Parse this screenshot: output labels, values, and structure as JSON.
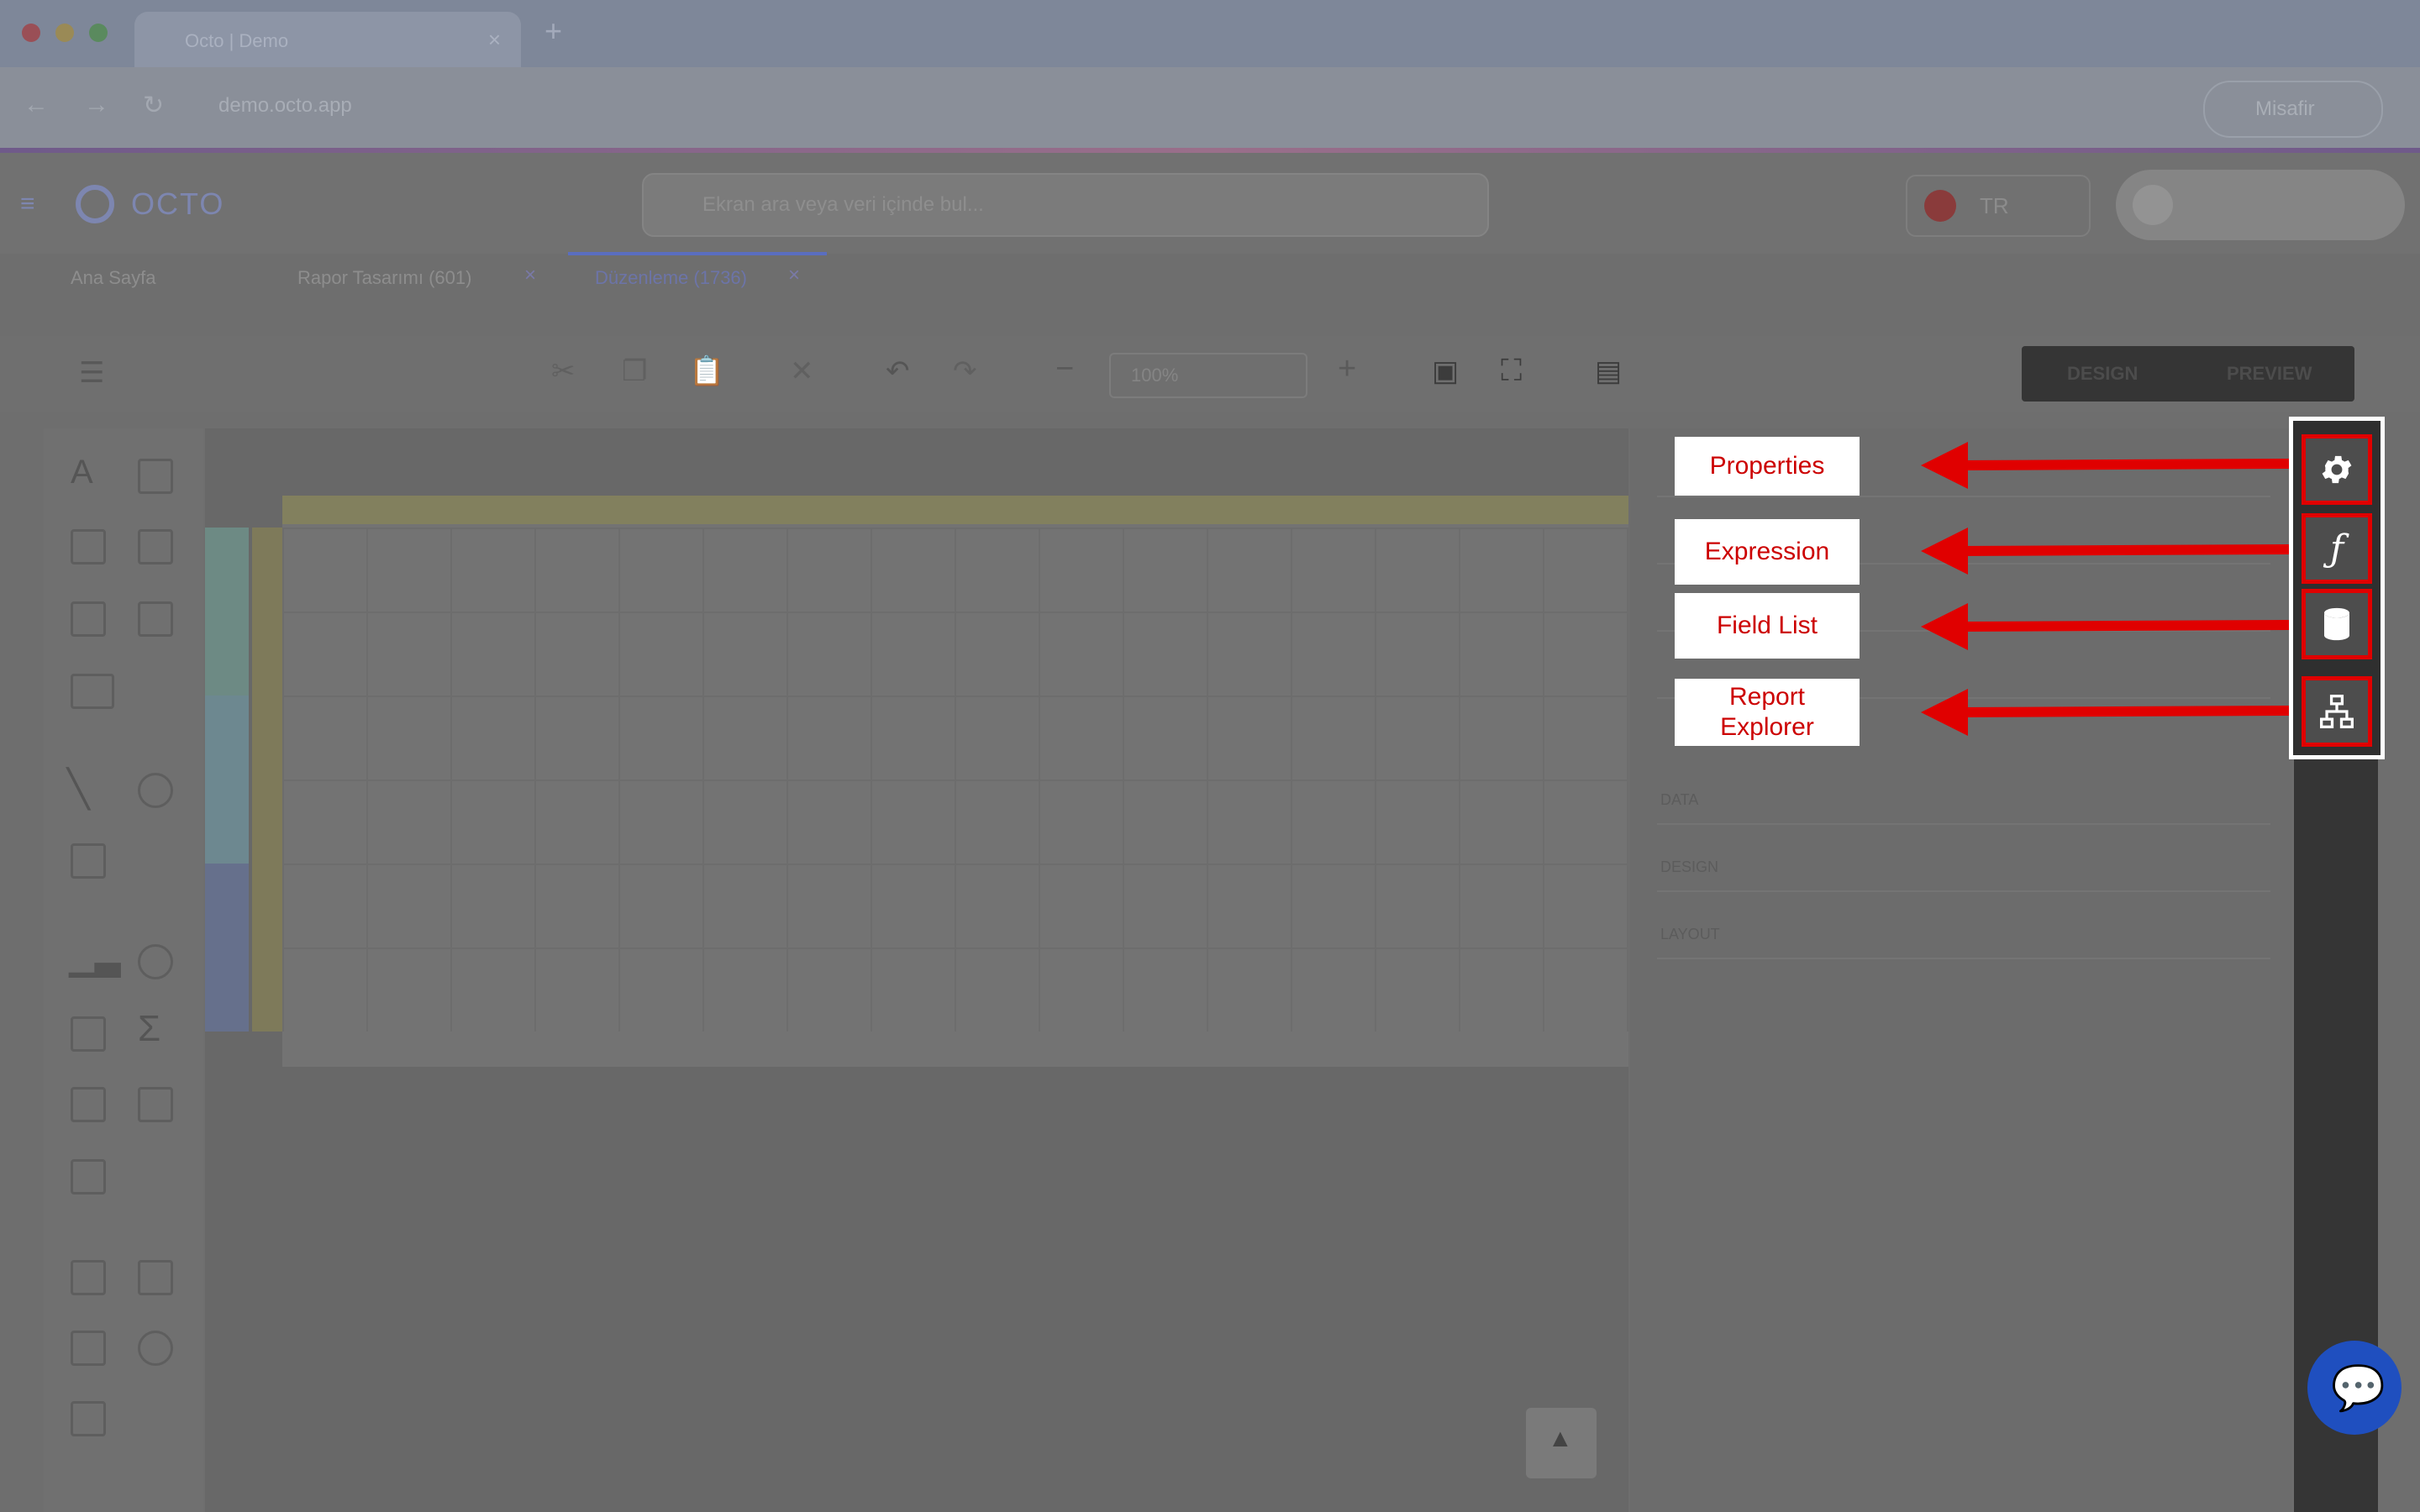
{
  "browser": {
    "tab_title": "Octo | Demo",
    "url": "demo.octo.app",
    "window_button": "Misafir"
  },
  "app": {
    "logo": "OCTO",
    "search_placeholder": "Ekran ara veya veri içinde bul...",
    "language": "TR"
  },
  "doc_tabs": [
    {
      "label": "Ana Sayfa"
    },
    {
      "label": "Rapor Tasarımı (601)"
    },
    {
      "label": "Düzenleme (1736)"
    }
  ],
  "toolbar": {
    "zoom": "100%",
    "design_label": "DESIGN",
    "preview_label": "PREVIEW"
  },
  "properties_panel": {
    "sections": [
      "DATA",
      "DESIGN",
      "LAYOUT"
    ]
  },
  "callouts": {
    "properties": "Properties",
    "expression": "Expression",
    "field_list": "Field List",
    "report_explorer": "Report Explorer"
  },
  "colors": {
    "highlight_red": "#e00000",
    "callout_text": "#cc0000"
  }
}
